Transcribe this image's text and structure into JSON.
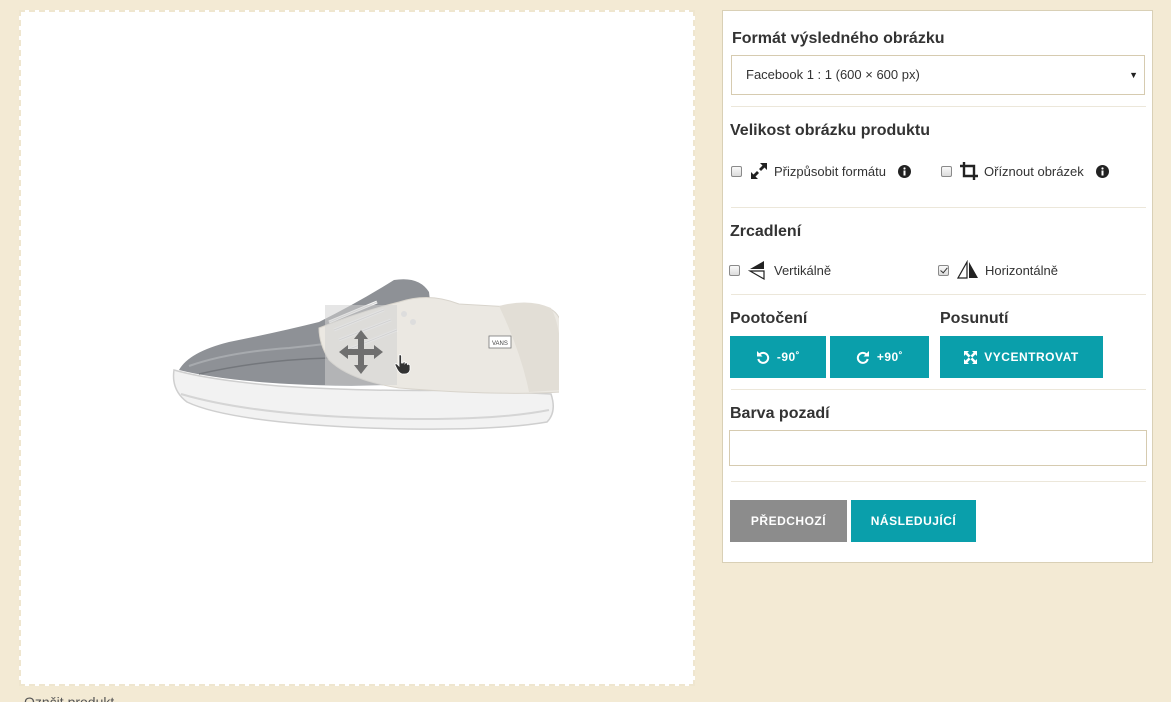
{
  "preview": {
    "bottom_text": "Oznčit produkt"
  },
  "panel": {
    "format_title": "Formát výsledného obrázku",
    "format_selected": "Facebook 1 : 1 (600 × 600 px)",
    "size_title": "Velikost obrázku produktu",
    "fit_label": "Přizpůsobit formátu",
    "crop_label": "Oříznout obrázek",
    "mirror_title": "Zrcadlení",
    "vertical_label": "Vertikálně",
    "horizontal_label": "Horizontálně",
    "vertical_checked": false,
    "horizontal_checked": true,
    "fit_checked": false,
    "crop_checked": false,
    "rotation_title": "Pootočení",
    "rotate_left_label": "-90˚",
    "rotate_right_label": "+90˚",
    "shift_title": "Posunutí",
    "center_label": "VYCENTROVAT",
    "bg_title": "Barva pozadí",
    "bg_value": "",
    "prev_label": "PŘEDCHOZÍ",
    "next_label": "NÁSLEDUJÍCÍ"
  },
  "colors": {
    "accent": "#0a9fab",
    "secondary": "#8c8c8c",
    "page_bg": "#f3ead4"
  }
}
